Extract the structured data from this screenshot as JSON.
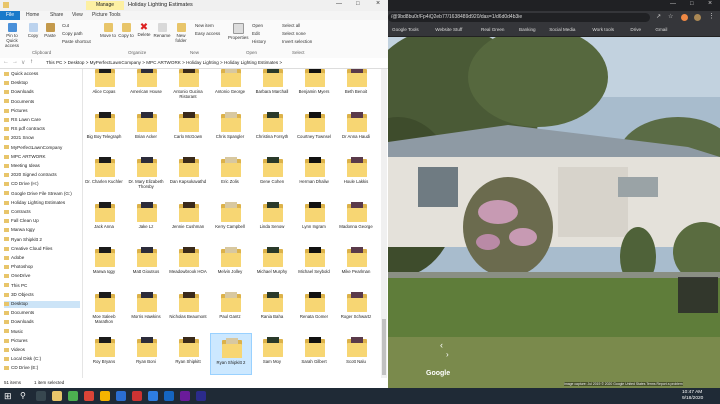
{
  "explorer": {
    "title": "Holiday Lighting Estimates",
    "manage_tab": "Manage",
    "ribbon_tabs": [
      "File",
      "Home",
      "Share",
      "View",
      "Picture Tools"
    ],
    "ribbon": {
      "pin": "Pin to Quick access",
      "copy": "Copy",
      "paste": "Paste",
      "cut": "Cut",
      "copy_path": "Copy path",
      "paste_shortcut": "Paste shortcut",
      "move_to": "Move to",
      "copy_to": "Copy to",
      "delete": "Delete",
      "rename": "Rename",
      "new_folder": "New folder",
      "new_item": "New item",
      "easy_access": "Easy access",
      "properties": "Properties",
      "open": "Open",
      "edit": "Edit",
      "history": "History",
      "select_all": "Select all",
      "select_none": "Select none",
      "invert_selection": "Invert selection",
      "groups": [
        "Clipboard",
        "Organize",
        "New",
        "Open",
        "Select"
      ]
    },
    "breadcrumb": "This PC  >  Desktop  >  MyPerfectLawnCompany  >  MPC ARTWORK  >  Holiday Lighting  >  Holiday Lighting Estimates  >",
    "nav": [
      "Quick access",
      "Desktop",
      "Downloads",
      "Documents",
      "Pictures",
      "RS Lawn Care",
      "RS pdf contracts",
      "2021 Snow",
      "MyPerfectLawnCompany",
      "MPC ARTWORK",
      "Meeting Ideas",
      "2020 Signed contracts",
      "CD Drive (H:)",
      "Google Drive File Stream (G:)",
      "Holiday Lighting Estimates",
      "Contracts",
      "Fall Clean Up",
      "Marwa Iqgy",
      "Ryan Shipkitt 2",
      "Creative Cloud Files",
      "Adobe",
      "Photoshop",
      "OneDrive",
      "This PC",
      "3D Objects",
      "Desktop",
      "Documents",
      "Downloads",
      "Music",
      "Pictures",
      "Videos",
      "Local Disk (C:)",
      "CD Drive (E:)"
    ],
    "selected_nav_index": 25,
    "files": [
      "Alice Copas",
      "American House",
      "Antonio Gucina Ristorant",
      "Antonio George",
      "Barbara Marchall",
      "Benjamin Myers",
      "Beth Benoit",
      "Big Boy Telegraph",
      "Brian Acker",
      "Carlo McGown",
      "Chris Spangler",
      "Christina Forsyth",
      "Courtney Townsel",
      "Dr Anna Haudi",
      "Dr. Charlen Kuchler",
      "Dr. Mary Elizabeth Thorsby",
      "Dan Kapsokavathd",
      "Eric Zolis",
      "Gene Cohen",
      "Herman Dhaliw",
      "Houle Lakkis",
      "Jack Anna",
      "Jake Lz",
      "Jennie Cushman",
      "Kerry Campbell",
      "Linda Senow",
      "Lynn Ingram",
      "Madonna George",
      "Marwa Iqgy",
      "Matt Gioutsos",
      "Meadowbrook HOA",
      "Melvin Jolley",
      "Michael Murphy",
      "Michael Seybold",
      "Mike Pearlman",
      "Moe Saleeb Marathon",
      "Morris Hawkins",
      "Nicholas Beaumont",
      "Paul Gantz",
      "Rania Baha",
      "Renata Gomer",
      "Roger Schwartz",
      "Roy Bryans",
      "Ryan Boni",
      "Ryan Shipkitt",
      "Ryan Shipkitt 2",
      "Sam Moy",
      "Sarah Gilbert",
      "Scott Nalu"
    ],
    "selected_file_index": 45,
    "status_count": "51 items",
    "status_selected": "1 item selected"
  },
  "browser": {
    "url": "/@9bd8bu0r/Fp4iQ2eb77/1638489d920/das=1/d6d0d4b3ie",
    "bookmarks": [
      "Google Tools",
      "Website Stuff",
      "Real Green",
      "Banking",
      "Social Media",
      "Work tools",
      "Drive",
      "Gmail"
    ],
    "watermark": "Google",
    "imagery_info": "Image capture: Jul 2019   © 2020 Google   United States   Terms   Report a problem"
  },
  "taskbar": {
    "time": "10:47 AM",
    "date": "9/18/2020"
  }
}
